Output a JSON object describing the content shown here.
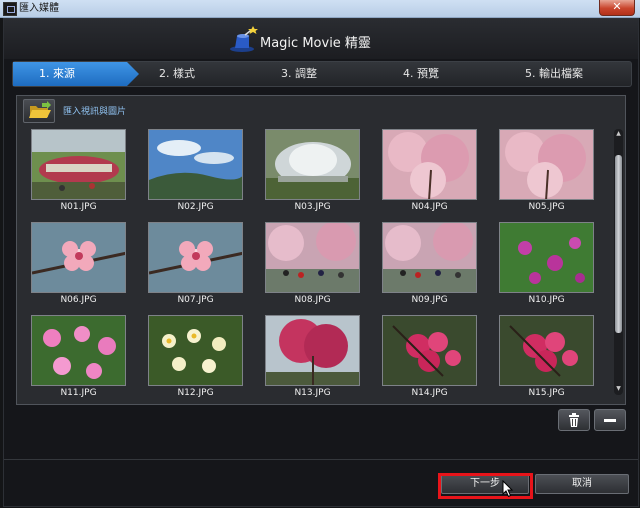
{
  "window": {
    "title": "匯入媒體",
    "close_glyph": "✕"
  },
  "app": {
    "logo_text": "Magic Movie 精靈",
    "logo_icon": "magic-hat-icon"
  },
  "steps": [
    {
      "label": "1. 來源",
      "active": true
    },
    {
      "label": "2. 樣式",
      "active": false
    },
    {
      "label": "3. 調整",
      "active": false
    },
    {
      "label": "4. 預覽",
      "active": false
    },
    {
      "label": "5. 輸出檔案",
      "active": false
    }
  ],
  "import": {
    "label": "匯入視訊與圖片",
    "icon": "folder-open-icon"
  },
  "colors": {
    "accent_blue": "#2b7fd1",
    "highlight_red": "#e8141a",
    "link_blue": "#8fc1ef"
  },
  "photos": [
    {
      "name": "N01.JPG",
      "scene": "garden"
    },
    {
      "name": "N02.JPG",
      "scene": "sky"
    },
    {
      "name": "N03.JPG",
      "scene": "fountain"
    },
    {
      "name": "N04.JPG",
      "scene": "pinktree"
    },
    {
      "name": "N05.JPG",
      "scene": "pinktree"
    },
    {
      "name": "N06.JPG",
      "scene": "blossom"
    },
    {
      "name": "N07.JPG",
      "scene": "blossom"
    },
    {
      "name": "N08.JPG",
      "scene": "crowd"
    },
    {
      "name": "N09.JPG",
      "scene": "crowd"
    },
    {
      "name": "N10.JPG",
      "scene": "purpleflowers"
    },
    {
      "name": "N11.JPG",
      "scene": "azalea"
    },
    {
      "name": "N12.JPG",
      "scene": "daffodil"
    },
    {
      "name": "N13.JPG",
      "scene": "redtree"
    },
    {
      "name": "N14.JPG",
      "scene": "redblossom"
    },
    {
      "name": "N15.JPG",
      "scene": "redblossom"
    }
  ],
  "tools": {
    "delete_icon": "trash-icon",
    "remove_icon": "minus-icon",
    "remove_glyph": "—"
  },
  "buttons": {
    "next": "下一步",
    "cancel": "取消"
  }
}
